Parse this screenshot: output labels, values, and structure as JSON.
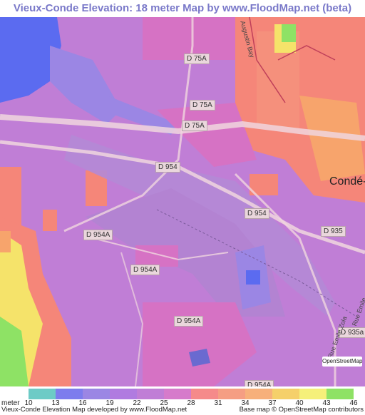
{
  "title": "Vieux-Conde Elevation: 18 meter Map by www.FloodMap.net (beta)",
  "colors": {
    "title": "#7a79c9",
    "water": "#5b6bf0",
    "low_blue": "#8a86e6",
    "base_magenta": "#c07ed6",
    "pink": "#d672c4",
    "salmon": "#f58679",
    "orange": "#f7a46c",
    "yellow": "#f5e36a",
    "green": "#8ee265"
  },
  "road_labels": [
    "D 75A",
    "D 75A",
    "D 75A",
    "D 954",
    "D 954",
    "D 954A",
    "D 954A",
    "D 954A",
    "D 954A",
    "D 935",
    "D 935a"
  ],
  "place_labels": [
    "Condé-"
  ],
  "street_labels": [
    "Augustin Bay",
    "Rue Emile Zola",
    "Rue Emile..."
  ],
  "legend": {
    "unit_label": "meter",
    "ticks": [
      "10",
      "13",
      "16",
      "19",
      "22",
      "25",
      "28",
      "31",
      "34",
      "37",
      "40",
      "43",
      "46"
    ],
    "colors": [
      "#6dcbc6",
      "#7d7ced",
      "#9b86e4",
      "#b07be0",
      "#c07ed6",
      "#d67bcb",
      "#f58a8a",
      "#f59e83",
      "#f7b07b",
      "#f5d06a",
      "#f5f07a",
      "#8ee265",
      "#7ad868"
    ]
  },
  "credits": {
    "left": "Vieux-Conde Elevation Map developed by www.FloodMap.net",
    "right": "Base map © OpenStreetMap contributors"
  },
  "osm_badge": "OpenStreetMap"
}
